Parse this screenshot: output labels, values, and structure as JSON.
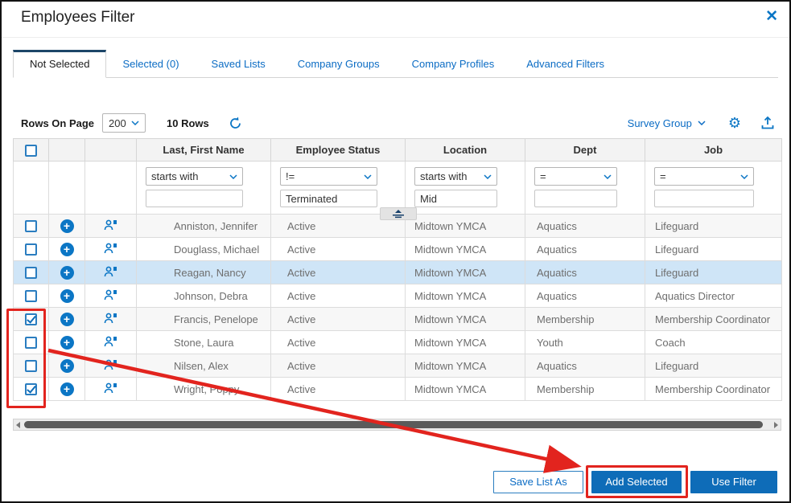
{
  "dialog": {
    "title": "Employees Filter",
    "close_label": "✕"
  },
  "tabs": [
    {
      "label": "Not Selected",
      "active": true
    },
    {
      "label": "Selected (0)",
      "active": false
    },
    {
      "label": "Saved Lists",
      "active": false
    },
    {
      "label": "Company Groups",
      "active": false
    },
    {
      "label": "Company Profiles",
      "active": false
    },
    {
      "label": "Advanced Filters",
      "active": false
    }
  ],
  "toolbar": {
    "rows_on_page_label": "Rows On Page",
    "page_size": "200",
    "row_count": "10 Rows",
    "survey_group_label": "Survey Group"
  },
  "table": {
    "columns": [
      "Last, First Name",
      "Employee Status",
      "Location",
      "Dept",
      "Job"
    ],
    "filters": [
      {
        "operator": "starts with",
        "value": ""
      },
      {
        "operator": "!=",
        "value": "Terminated"
      },
      {
        "operator": "starts with",
        "value": "Mid"
      },
      {
        "operator": "=",
        "value": ""
      },
      {
        "operator": "=",
        "value": ""
      }
    ],
    "rows": [
      {
        "name": "Anniston, Jennifer",
        "status": "Active",
        "location": "Midtown YMCA",
        "dept": "Aquatics",
        "job": "Lifeguard",
        "checked": false,
        "highlighted": false
      },
      {
        "name": "Douglass, Michael",
        "status": "Active",
        "location": "Midtown YMCA",
        "dept": "Aquatics",
        "job": "Lifeguard",
        "checked": false,
        "highlighted": false
      },
      {
        "name": "Reagan, Nancy",
        "status": "Active",
        "location": "Midtown YMCA",
        "dept": "Aquatics",
        "job": "Lifeguard",
        "checked": false,
        "highlighted": true
      },
      {
        "name": "Johnson, Debra",
        "status": "Active",
        "location": "Midtown YMCA",
        "dept": "Aquatics",
        "job": "Aquatics Director",
        "checked": false,
        "highlighted": false
      },
      {
        "name": "Francis, Penelope",
        "status": "Active",
        "location": "Midtown YMCA",
        "dept": "Membership",
        "job": "Membership Coordinator",
        "checked": true,
        "highlighted": false
      },
      {
        "name": "Stone, Laura",
        "status": "Active",
        "location": "Midtown YMCA",
        "dept": "Youth",
        "job": "Coach",
        "checked": false,
        "highlighted": false
      },
      {
        "name": "Nilsen, Alex",
        "status": "Active",
        "location": "Midtown YMCA",
        "dept": "Aquatics",
        "job": "Lifeguard",
        "checked": false,
        "highlighted": false
      },
      {
        "name": "Wright, Poppy",
        "status": "Active",
        "location": "Midtown YMCA",
        "dept": "Membership",
        "job": "Membership Coordinator",
        "checked": true,
        "highlighted": false
      }
    ]
  },
  "footer": {
    "save_list_as": "Save List As",
    "add_selected": "Add Selected",
    "use_filter": "Use Filter"
  },
  "colors": {
    "accent_blue": "#0b76c5",
    "button_blue": "#0e6cb8",
    "active_tab_border": "#1c4668",
    "row_highlight": "#cfe5f7",
    "annotation_red": "#e2241e"
  }
}
